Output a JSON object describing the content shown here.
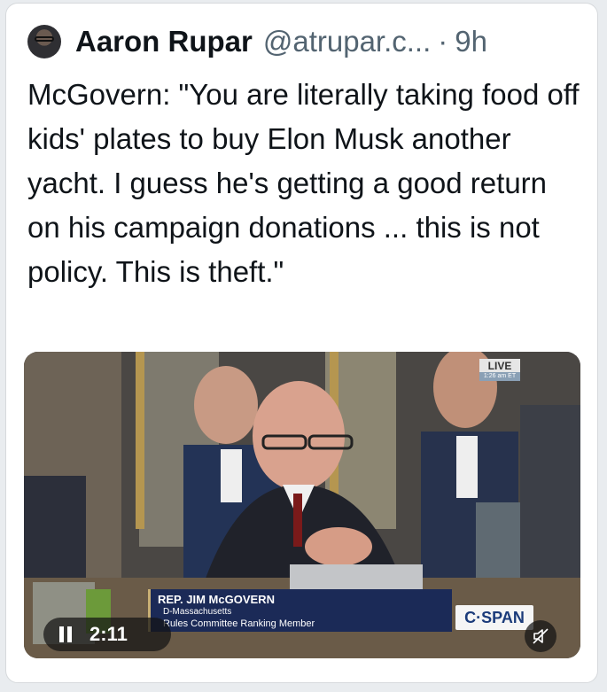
{
  "tweet": {
    "author_name": "Aaron Rupar",
    "author_handle": "@atrupar.c...",
    "separator": "·",
    "time": "9h",
    "text": "McGovern: \"You are literally taking food off kids' plates to buy Elon Musk another yacht. I guess he's getting a good return on his campaign donations ... this is not policy. This is theft.\""
  },
  "video": {
    "live_label": "LIVE",
    "live_time": "1:26 am ET",
    "lower_third": {
      "name": "REP. JIM McGOVERN",
      "state": "D-Massachusetts",
      "role": "Rules Committee Ranking Member"
    },
    "network": "C·SPAN",
    "duration": "2:11",
    "play_state_icon": "pause-icon",
    "mute_icon": "muted-speaker-icon"
  },
  "colors": {
    "text_primary": "#0f1419",
    "text_secondary": "#536471",
    "lower_third_bg": "#1b2a57"
  }
}
